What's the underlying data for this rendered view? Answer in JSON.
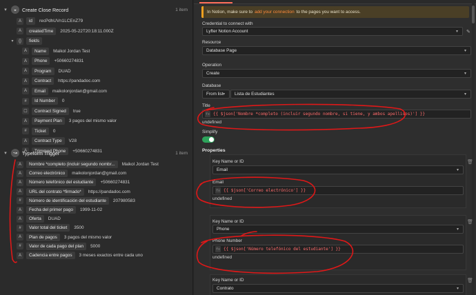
{
  "left": {
    "create_node": {
      "title": "Create Close Record",
      "count": "1 item",
      "rows": [
        {
          "type": "A",
          "key": "id",
          "value": "recPdhUVn1LCEnZ79"
        },
        {
          "type": "A",
          "key": "createdTime",
          "value": "2025-05-22T20:18:11.000Z"
        },
        {
          "type": "{}",
          "key": "fields",
          "value": ""
        },
        {
          "type": "A",
          "key": "Name",
          "value": "Maikol Jordan Test"
        },
        {
          "type": "A",
          "key": "Phone",
          "value": "+50660274831"
        },
        {
          "type": "A",
          "key": "Program",
          "value": "DUAD"
        },
        {
          "type": "A",
          "key": "Contract",
          "value": "https://pandadoc.com"
        },
        {
          "type": "A",
          "key": "Email",
          "value": "maikolonjordan@gmail.com"
        },
        {
          "type": "#",
          "key": "Id Number",
          "value": "0"
        },
        {
          "type": "☐",
          "key": "Contract Signed",
          "value": "true"
        },
        {
          "type": "A",
          "key": "Payment Plan",
          "value": "3 pagos del mismo valor"
        },
        {
          "type": "#",
          "key": "Ticket",
          "value": "0"
        },
        {
          "type": "A",
          "key": "Contract Type",
          "value": "V28"
        },
        {
          "type": "A",
          "key": "Trimmed Phone",
          "value": "+50660274831"
        }
      ]
    },
    "typeform_node": {
      "title": "Typeform Trigger",
      "count": "1 item",
      "rows": [
        {
          "type": "A",
          "key": "Nombre *completo (incluir segundo nombr...",
          "value": "Maikol Jordan Test"
        },
        {
          "type": "A",
          "key": "Correo electrónico",
          "value": "maikolonjordan@gmail.com"
        },
        {
          "type": "A",
          "key": "Número telefónico del estudiante",
          "value": "+50660274831"
        },
        {
          "type": "A",
          "key": "URL del contrato *firmado*",
          "value": "https://pandadoc.com"
        },
        {
          "type": "#",
          "key": "Número de identificación del estudiante",
          "value": "207980583"
        },
        {
          "type": "A",
          "key": "Fecha del primer pago",
          "value": "1999-11-02"
        },
        {
          "type": "A",
          "key": "Oferta",
          "value": "DUAD"
        },
        {
          "type": "#",
          "key": "Valor total del ticket",
          "value": "3500"
        },
        {
          "type": "A",
          "key": "Plan de pagos",
          "value": "3 pagos del mismo valor"
        },
        {
          "type": "#",
          "key": "Valor de cada pago del plan",
          "value": "5000"
        },
        {
          "type": "A",
          "key": "Cadencia entre pagos",
          "value": "3 meses exactos entre cada uno"
        }
      ]
    }
  },
  "right": {
    "notice_prefix": "In Notion, make sure to",
    "notice_link": "add your connection",
    "notice_suffix": "to the pages you want to access.",
    "credential_label": "Credential to connect with",
    "credential_value": "Lyfter Notion Account",
    "resource_label": "Resource",
    "resource_value": "Database Page",
    "operation_label": "Operation",
    "operation_value": "Create",
    "database_label": "Database",
    "database_mode": "From list",
    "database_value": "Lista de Estudiantes",
    "title_label": "Title",
    "title_expr": "{{ $json['Nombre *completo (incluir segundo nombre, si tiene, y ambos apellidos)'] }}",
    "title_result": "undefined",
    "simplify_label": "Simplify",
    "properties_label": "Properties",
    "props": [
      {
        "key_label": "Key Name or ID",
        "key_value": "Email",
        "field_label": "Email",
        "expr": "{{ $json['Correo electrónico'] }}",
        "result": "undefined"
      },
      {
        "key_label": "Key Name or ID",
        "key_value": "Phone",
        "field_label": "Phone Number",
        "expr": "{{ $json['Número telefónico del estudiante'] }}",
        "result": "undefined"
      },
      {
        "key_label": "Key Name or ID",
        "key_value": "Contrato"
      }
    ]
  },
  "colors": {
    "accent": "#ff6d5a",
    "annotation": "#e01818",
    "toggle": "#2ea35b"
  }
}
